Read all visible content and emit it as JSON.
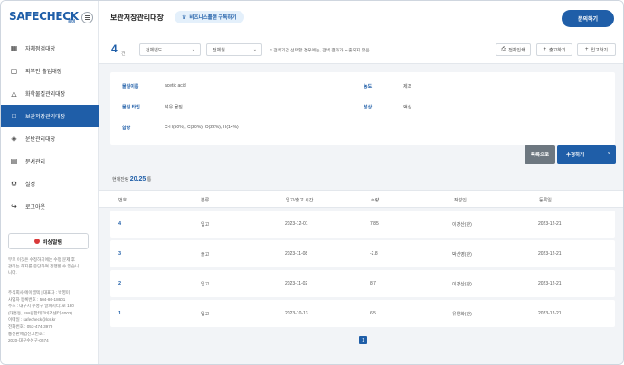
{
  "brand": {
    "logo": "SAFECHECK",
    "logo_sub": "로비"
  },
  "sidebar": {
    "items": [
      {
        "label": "자체점검대장",
        "icon": "document-icon",
        "active": false
      },
      {
        "label": "외부인 출입대장",
        "icon": "visitor-icon",
        "active": false
      },
      {
        "label": "화학물질관리대장",
        "icon": "flask-icon",
        "active": false
      },
      {
        "label": "보관저장관리대장",
        "icon": "folder-icon",
        "active": true
      },
      {
        "label": "운반관리대장",
        "icon": "truck-icon",
        "active": false
      },
      {
        "label": "문서관리",
        "icon": "file-icon",
        "active": false
      },
      {
        "label": "설정",
        "icon": "gear-icon",
        "active": false
      },
      {
        "label": "로그아웃",
        "icon": "logout-icon",
        "active": false
      }
    ],
    "emergency_label": "비상알림",
    "note_lines": [
      "부모 이것은 수정하기에는 수정 문제 후",
      "관리는 해지를 중단하여 진행할 수 있습니",
      "니다."
    ],
    "info_lines": [
      "주식회사 에이엠텍 | 대표자 : 박영미",
      "사업자 등록번호 : 504-86-18601",
      "주소 : 대구시 수성구 알파시티1로 180",
      "(대흥동, SW융합테크비즈센터 4002)",
      "이메일 : safecheck@lcs.kr",
      "전화번호 : 053-474-3979",
      "통신판매업신고번호 :",
      "2020-대구수성구-0574"
    ]
  },
  "header": {
    "title": "보관저장관리대장",
    "subscribe_label": "비즈니스플랜 구독하기",
    "contact_label": "문의하기"
  },
  "toolbar": {
    "count": "4",
    "count_unit": "건",
    "select_year": "전체년도",
    "select_month": "전체월",
    "notice": "* 검색기간 선택할 경우에는, 검색 결과가 노출되지 않음",
    "print_label": "전체인쇄",
    "out_label": "출고하기",
    "in_label": "입고하기"
  },
  "info": {
    "substance_label": "물질이름",
    "substance_value": "acetic acid",
    "concentration_label": "농도",
    "concentration_value": "제조",
    "type_label": "물질 타입",
    "type_value": "석유 물질",
    "state_label": "성상",
    "state_value": "액상",
    "content_label": "함량",
    "content_value": "C-H(50%), C(20%), O(22%), H(14%)"
  },
  "actions": {
    "list_label": "목록으로",
    "edit_label": "수정하기"
  },
  "stock": {
    "prefix": "현재잔량",
    "value": "20.25",
    "unit": "통"
  },
  "table": {
    "headers": [
      "번호",
      "분류",
      "입고/출고 시간",
      "수량",
      "작성인",
      "등록일"
    ],
    "rows": [
      {
        "no": "4",
        "type": "입고",
        "date": "2023-12-01",
        "qty": "7.85",
        "writer": "이강산(관)",
        "reg": "2023-12-21"
      },
      {
        "no": "3",
        "type": "출고",
        "date": "2023-11-08",
        "qty": "-2.8",
        "writer": "박신영(관)",
        "reg": "2023-12-21"
      },
      {
        "no": "2",
        "type": "입고",
        "date": "2023-11-02",
        "qty": "8.7",
        "writer": "이강산(관)",
        "reg": "2023-12-21"
      },
      {
        "no": "1",
        "type": "입고",
        "date": "2023-10-13",
        "qty": "6.5",
        "writer": "유연화(관)",
        "reg": "2023-12-21"
      }
    ]
  },
  "pagination": {
    "current": "1"
  },
  "colors": {
    "primary": "#1f5ea8",
    "emergency": "#d93a3a",
    "list_button": "#6d7780"
  }
}
